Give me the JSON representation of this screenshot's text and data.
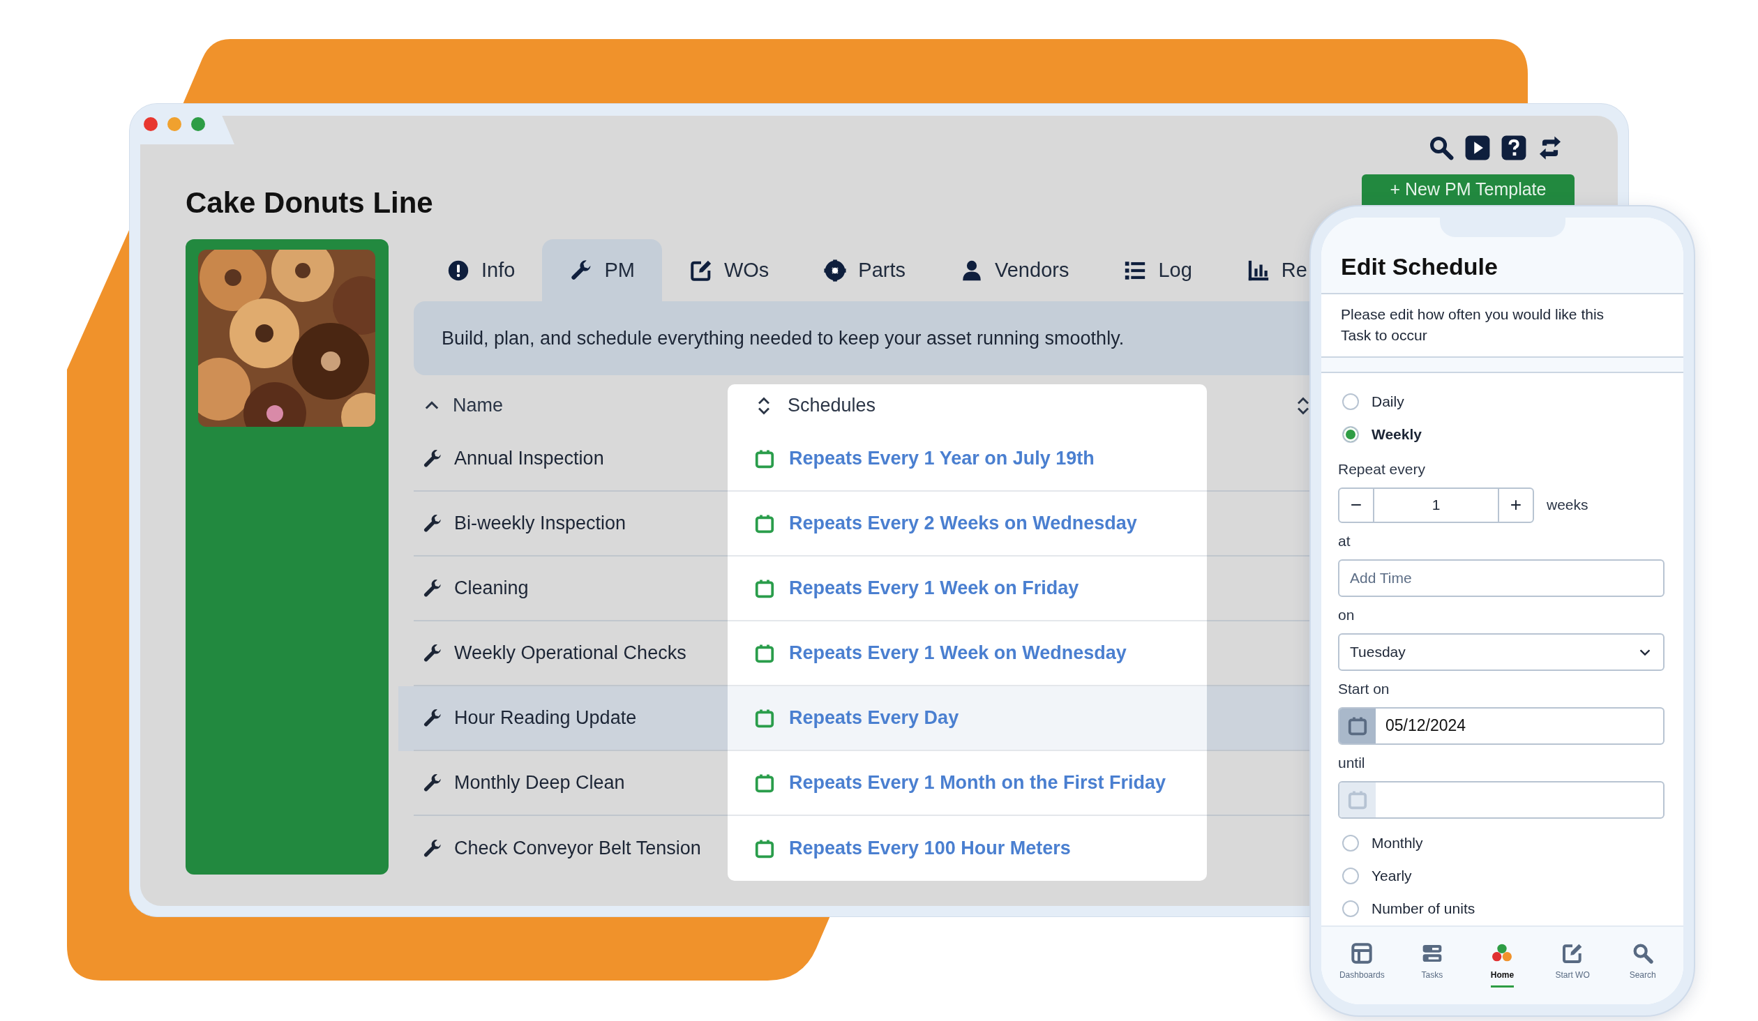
{
  "window": {
    "title": "Cake Donuts Line"
  },
  "toolbar": {
    "new_button": "+ New PM Template"
  },
  "tabs": [
    {
      "label": "Info",
      "selected": false
    },
    {
      "label": "PM",
      "selected": true
    },
    {
      "label": "WOs",
      "selected": false
    },
    {
      "label": "Parts",
      "selected": false
    },
    {
      "label": "Vendors",
      "selected": false
    },
    {
      "label": "Log",
      "selected": false
    },
    {
      "label": "Re",
      "selected": false
    }
  ],
  "banner": "Build, plan, and schedule everything needed to keep your asset running smoothly.",
  "table": {
    "columns": [
      "Name",
      "Schedules"
    ],
    "rows": [
      {
        "name": "Annual Inspection",
        "schedule": "Repeats Every 1 Year on July 19th",
        "selected": false
      },
      {
        "name": "Bi-weekly Inspection",
        "schedule": "Repeats Every 2 Weeks on Wednesday",
        "selected": false
      },
      {
        "name": "Cleaning",
        "schedule": "Repeats Every 1 Week on Friday",
        "selected": false
      },
      {
        "name": "Weekly Operational Checks",
        "schedule": "Repeats Every 1 Week on Wednesday",
        "selected": false
      },
      {
        "name": "Hour Reading Update",
        "schedule": "Repeats Every Day",
        "selected": true
      },
      {
        "name": "Monthly Deep Clean",
        "schedule": "Repeats Every 1 Month on the First Friday",
        "selected": false
      },
      {
        "name": "Check Conveyor Belt Tension",
        "schedule": "Repeats Every 100 Hour Meters",
        "selected": false
      }
    ]
  },
  "edit_schedule": {
    "title": "Edit Schedule",
    "description": "Please edit how often you would like this Task to occur",
    "options_top": [
      {
        "label": "Daily",
        "selected": false
      },
      {
        "label": "Weekly",
        "selected": true
      }
    ],
    "repeat_label": "Repeat every",
    "decrement": "−",
    "repeat_value": "1",
    "increment": "+",
    "repeat_unit": "weeks",
    "at_label": "at",
    "time_placeholder": "Add Time",
    "on_label": "on",
    "day_value": "Tuesday",
    "start_label": "Start on",
    "start_value": "05/12/2024",
    "until_label": "until",
    "options_bottom": [
      {
        "label": "Monthly",
        "selected": false
      },
      {
        "label": "Yearly",
        "selected": false
      },
      {
        "label": "Number of units",
        "selected": false
      }
    ]
  },
  "bottom_nav": [
    {
      "label": "Dashboards",
      "selected": false
    },
    {
      "label": "Tasks",
      "selected": false
    },
    {
      "label": "Home",
      "selected": true
    },
    {
      "label": "Start WO",
      "selected": false
    },
    {
      "label": "Search",
      "selected": false
    }
  ]
}
